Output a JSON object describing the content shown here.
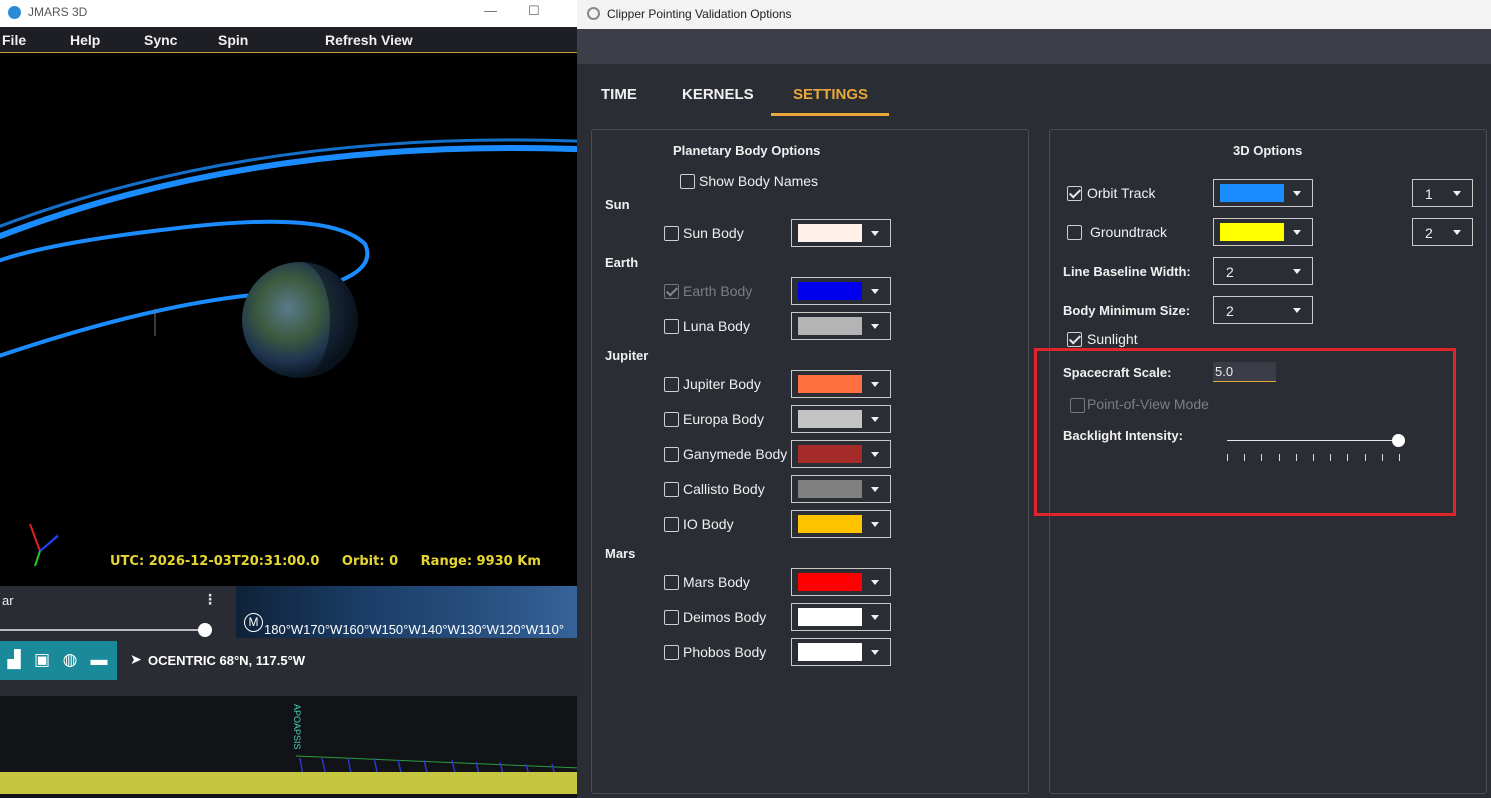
{
  "jmars": {
    "window_title": "JMARS 3D",
    "menu": [
      "File",
      "Help",
      "Sync",
      "Spin",
      "Refresh View"
    ],
    "hud": {
      "utc": "UTC: 2026-12-03T20:31:00.0",
      "orbit": "Orbit:  0",
      "range": "Range: 9930 Km"
    },
    "lower_label": "ar",
    "menu_dots": "⋮",
    "map_badge": "M",
    "longitudes": "180°W170°W160°W150°W140°W130°W120°W110°",
    "coord_readout": "OCENTRIC  68°N, 117.5°W",
    "timeline_marker": "APOAPSIS"
  },
  "dialog": {
    "window_title": "Clipper Pointing Validation Options",
    "tabs": [
      {
        "label": "TIME",
        "active": false
      },
      {
        "label": "KERNELS",
        "active": false
      },
      {
        "label": "SETTINGS",
        "active": true
      }
    ],
    "planetary": {
      "title": "Planetary Body Options",
      "show_body_names": {
        "label": "Show Body Names",
        "checked": false
      },
      "groups": [
        {
          "name": "Sun",
          "bodies": [
            {
              "label": "Sun Body",
              "checked": false,
              "disabled": false,
              "color": "#fff1ea"
            }
          ]
        },
        {
          "name": "Earth",
          "bodies": [
            {
              "label": "Earth Body",
              "checked": true,
              "disabled": true,
              "color": "#0000ee"
            },
            {
              "label": "Luna Body",
              "checked": false,
              "disabled": false,
              "color": "#b4b4b4"
            }
          ]
        },
        {
          "name": "Jupiter",
          "bodies": [
            {
              "label": "Jupiter Body",
              "checked": false,
              "disabled": false,
              "color": "#ff7040"
            },
            {
              "label": "Europa Body",
              "checked": false,
              "disabled": false,
              "color": "#c4c4c4"
            },
            {
              "label": "Ganymede Body",
              "checked": false,
              "disabled": false,
              "color": "#a52a2a"
            },
            {
              "label": "Callisto Body",
              "checked": false,
              "disabled": false,
              "color": "#808080"
            },
            {
              "label": "IO Body",
              "checked": false,
              "disabled": false,
              "color": "#ffc400"
            }
          ]
        },
        {
          "name": "Mars",
          "bodies": [
            {
              "label": "Mars Body",
              "checked": false,
              "disabled": false,
              "color": "#ff0000"
            },
            {
              "label": "Deimos Body",
              "checked": false,
              "disabled": false,
              "color": "#ffffff"
            },
            {
              "label": "Phobos Body",
              "checked": false,
              "disabled": false,
              "color": "#ffffff"
            }
          ]
        }
      ]
    },
    "options3d": {
      "title": "3D Options",
      "orbit_track": {
        "label": "Orbit Track",
        "checked": true,
        "color": "#1a8cff",
        "width": "1"
      },
      "groundtrack": {
        "label": "Groundtrack",
        "checked": false,
        "color": "#ffff00",
        "width": "2"
      },
      "line_baseline_width": {
        "label": "Line Baseline Width:",
        "value": "2"
      },
      "body_minimum_size": {
        "label": "Body Minimum Size:",
        "value": "2"
      },
      "sunlight": {
        "label": "Sunlight",
        "checked": true
      },
      "spacecraft_scale": {
        "label": "Spacecraft Scale:",
        "value": "5.0"
      },
      "pov_mode": {
        "label": "Point-of-View Mode",
        "checked": false,
        "disabled": true
      },
      "backlight": {
        "label": "Backlight Intensity:",
        "value": 1.0,
        "ticks": 11
      }
    }
  },
  "colors": {
    "accent": "#e8a83a",
    "highlight": "#e0262b",
    "hud_text": "#e6d633"
  }
}
